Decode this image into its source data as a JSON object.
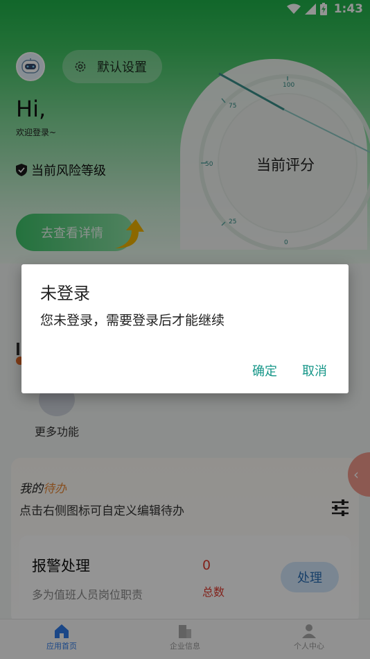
{
  "status_bar": {
    "time": "1:43"
  },
  "header": {
    "settings_label": "默认设置",
    "greeting": "Hi,",
    "welcome": "欢迎登录~",
    "risk_label": "当前风险等级",
    "detail_button": "去查看详情"
  },
  "gauge": {
    "label": "当前评分",
    "ticks": [
      "100",
      "75",
      "50",
      "25",
      "0"
    ]
  },
  "features": {
    "more_label": "更多功能"
  },
  "todo": {
    "title_prefix": "我的",
    "title_accent": "待办",
    "subtitle": "点击右侧图标可自定义编辑待办"
  },
  "alarm": {
    "title": "报警处理",
    "description": "多为值班人员岗位职责",
    "count": "0",
    "count_label": "总数",
    "handle_button": "处理"
  },
  "tabbar": {
    "tabs": [
      {
        "label": "应用首页"
      },
      {
        "label": "企业信息"
      },
      {
        "label": "个人中心"
      }
    ]
  },
  "dialog": {
    "title": "未登录",
    "message": "您未登录，需要登录后才能继续",
    "confirm": "确定",
    "cancel": "取消"
  },
  "colors": {
    "brand_green": "#1fb14a",
    "dialog_button": "#159688",
    "alert_red": "#e03b2f",
    "active_tab": "#2f7be8"
  }
}
